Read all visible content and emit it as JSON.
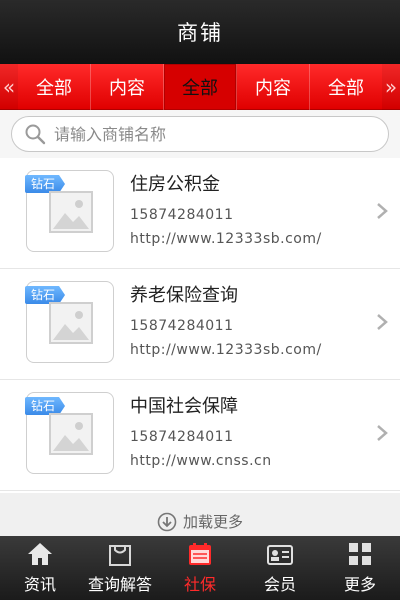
{
  "header": {
    "title": "商铺"
  },
  "tabs": {
    "left_arrow": "«",
    "right_arrow": "»",
    "items": [
      {
        "label": "全部"
      },
      {
        "label": "内容"
      },
      {
        "label": "全部",
        "active": true
      },
      {
        "label": "内容"
      },
      {
        "label": "全部"
      }
    ]
  },
  "search": {
    "placeholder": "请输入商铺名称"
  },
  "shops": [
    {
      "badge": "钻石",
      "name": "住房公积金",
      "phone": "15874284011",
      "url": "http://www.12333sb.com/"
    },
    {
      "badge": "钻石",
      "name": "养老保险查询",
      "phone": "15874284011",
      "url": "http://www.12333sb.com/"
    },
    {
      "badge": "钻石",
      "name": "中国社会保障",
      "phone": "15874284011",
      "url": "http://www.cnss.cn"
    }
  ],
  "load_more": "加载更多",
  "bottom_nav": [
    {
      "label": "资讯",
      "icon": "home-icon"
    },
    {
      "label": "查询解答",
      "icon": "bag-icon"
    },
    {
      "label": "社保",
      "icon": "calendar-icon",
      "active": true
    },
    {
      "label": "会员",
      "icon": "member-card-icon"
    },
    {
      "label": "更多",
      "icon": "grid-icon"
    }
  ],
  "colors": {
    "accent_red": "#e00000",
    "active_nav": "#ff2a2a",
    "badge_blue": "#3a8ae8"
  }
}
